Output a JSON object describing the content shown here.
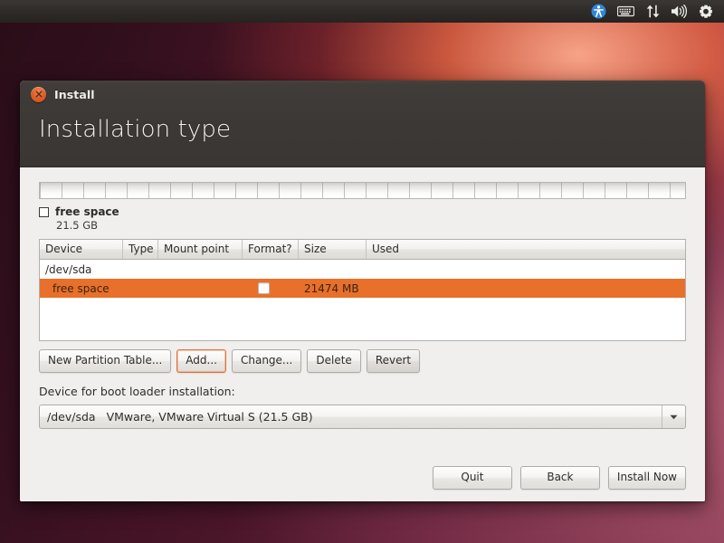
{
  "top_panel": {
    "icons": [
      {
        "name": "accessibility-icon",
        "label": "Universal Access"
      },
      {
        "name": "keyboard-icon",
        "label": "Keyboard Layout"
      },
      {
        "name": "network-icon",
        "label": "Network"
      },
      {
        "name": "volume-icon",
        "label": "Volume"
      },
      {
        "name": "system-settings-icon",
        "label": "System"
      }
    ]
  },
  "window": {
    "title": "Install",
    "page_title": "Installation type",
    "close_label": "Close"
  },
  "disk_legend": {
    "name": "free space",
    "size": "21.5 GB"
  },
  "partition_table": {
    "headers": [
      "Device",
      "Type",
      "Mount point",
      "Format?",
      "Size",
      "Used"
    ],
    "rows": [
      {
        "device": "/dev/sda",
        "type": "",
        "mount_point": "",
        "format": null,
        "size": "",
        "used": "",
        "selected": false,
        "indent": false
      },
      {
        "device": "free space",
        "type": "",
        "mount_point": "",
        "format": false,
        "size": "21474 MB",
        "used": "",
        "selected": true,
        "indent": true
      }
    ]
  },
  "partition_actions": [
    {
      "label": "New Partition Table...",
      "name": "new-partition-table-button",
      "focused": false,
      "dim": false
    },
    {
      "label": "Add...",
      "name": "add-partition-button",
      "focused": true,
      "dim": false
    },
    {
      "label": "Change...",
      "name": "change-partition-button",
      "focused": false,
      "dim": false
    },
    {
      "label": "Delete",
      "name": "delete-partition-button",
      "focused": false,
      "dim": false
    },
    {
      "label": "Revert",
      "name": "revert-button",
      "focused": false,
      "dim": true
    }
  ],
  "bootloader": {
    "label": "Device for boot loader installation:",
    "device": "/dev/sda",
    "description": "VMware, VMware Virtual S (21.5 GB)"
  },
  "footer_actions": [
    {
      "label": "Quit",
      "name": "quit-button"
    },
    {
      "label": "Back",
      "name": "back-button"
    },
    {
      "label": "Install Now",
      "name": "install-now-button"
    }
  ],
  "colors": {
    "selection_orange": "#e8702a",
    "focus_orange": "#e4713a",
    "header_dark": "#3c3835",
    "window_bg": "#f0efee",
    "accessibility_blue": "#2e86d6"
  }
}
